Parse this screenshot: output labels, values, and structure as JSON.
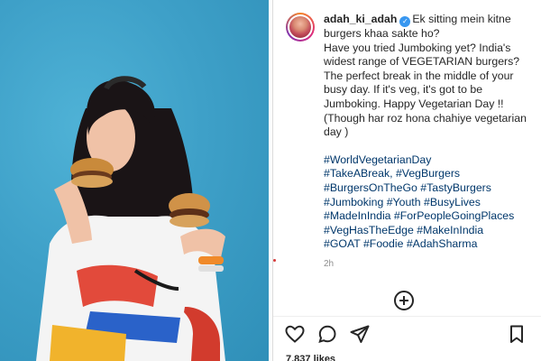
{
  "post": {
    "username": "adah_ki_adah",
    "caption_lines": [
      "Ek sitting mein kitne burgers khaa sakte ho?",
      "Have you tried Jumboking yet? India's widest range of VEGETARIAN burgers? The perfect break in the middle of your busy day. If it's veg, it's got to be Jumboking. Happy Vegetarian Day !! (Though har roz hona chahiye vegetarian day )"
    ],
    "hashtags": [
      "#WorldVegetarianDay",
      "#TakeABreak, #VegBurgers",
      "#BurgersOnTheGo #TastyBurgers",
      "#Jumboking #Youth #BusyLives",
      "#MadeInIndia #ForPeopleGoingPlaces",
      "#VegHasTheEdge #MakeInIndia",
      "#GOAT #Foodie #AdahSharma"
    ],
    "time_ago": "2h",
    "likes": "7,837 likes"
  },
  "icons": {
    "verified": "verified-badge-icon",
    "add": "add-comment-icon",
    "like": "heart-icon",
    "comment": "comment-icon",
    "share": "send-icon",
    "save": "bookmark-icon"
  },
  "colors": {
    "accent_blue": "#3897f0",
    "hashtag": "#00376b",
    "photo_bg": "#3fa2c9"
  }
}
